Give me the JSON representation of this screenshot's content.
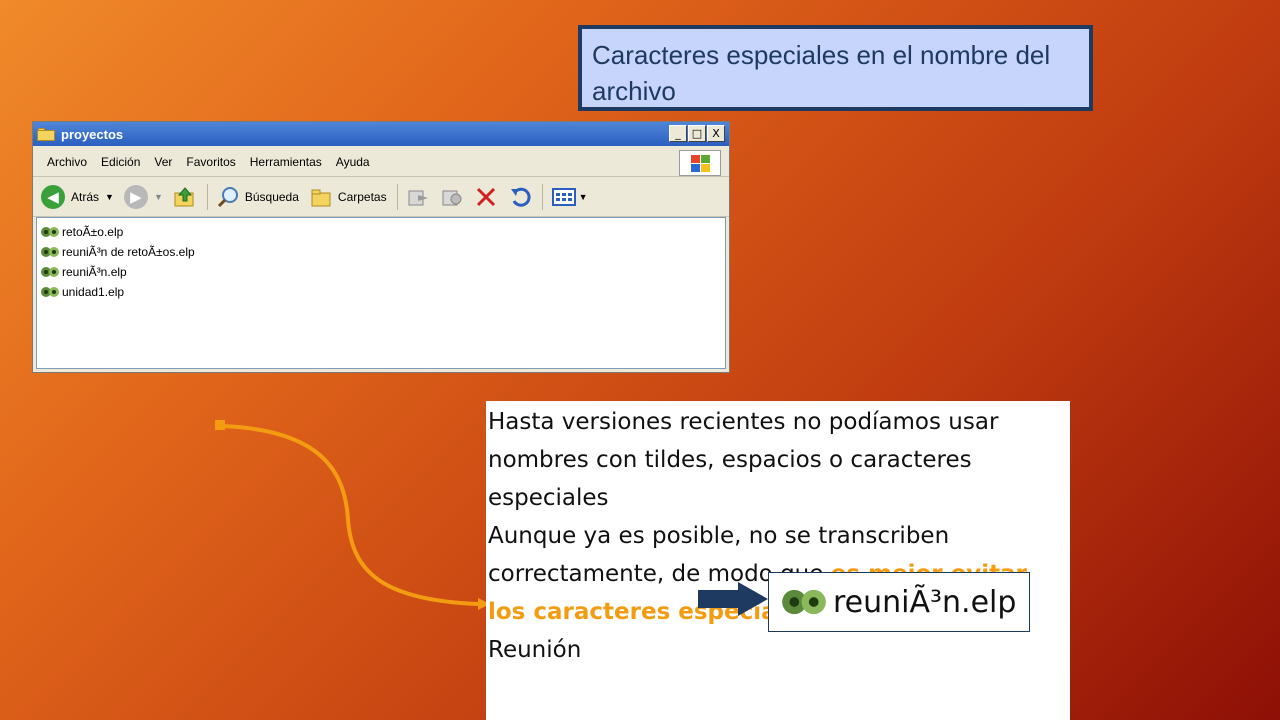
{
  "slide": {
    "title": "Caracteres especiales en el nombre del archivo"
  },
  "explorer": {
    "window_title": "proyectos",
    "window_buttons": [
      "_",
      "□",
      "X"
    ],
    "menu": [
      "Archivo",
      "Edición",
      "Ver",
      "Favoritos",
      "Herramientas",
      "Ayuda"
    ],
    "toolbar": {
      "back_label": "Atrás",
      "search_label": "Búsqueda",
      "folders_label": "Carpetas"
    },
    "files": [
      "retoÃ±o.elp",
      "reuniÃ³n de retoÃ±os.elp",
      "reuniÃ³n.elp",
      "unidad1.elp"
    ]
  },
  "text_box": {
    "para1": "Hasta versiones recientes no podíamos usar nombres con tildes, espacios o caracteres especiales",
    "para2_start": "Aunque ya es posible, no se transcriben correctamente, de modo que ",
    "para2_highlight": "es mejor evitar los caracteres especiales",
    "para3": "Reunión"
  },
  "zoom": {
    "filename": "reuniÃ³n.elp"
  },
  "colors": {
    "title_bg": "#c7d4fc",
    "title_border": "#1f3a60",
    "highlight": "#f39c12",
    "arrow": "#1f3a60",
    "curve": "#f39c12"
  }
}
